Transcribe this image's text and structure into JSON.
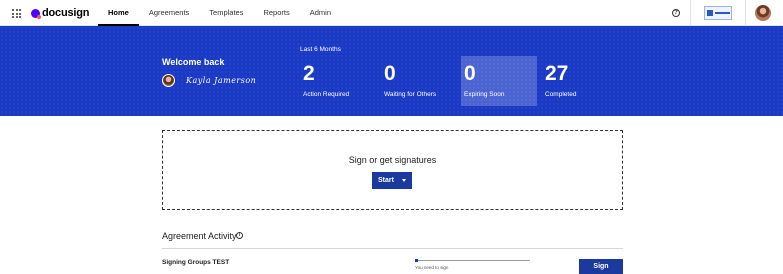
{
  "app": {
    "logo_text": "docusign"
  },
  "nav": {
    "items": [
      {
        "label": "Home",
        "active": true
      },
      {
        "label": "Agreements",
        "active": false
      },
      {
        "label": "Templates",
        "active": false
      },
      {
        "label": "Reports",
        "active": false
      },
      {
        "label": "Admin",
        "active": false
      }
    ],
    "help_glyph": "?"
  },
  "hero": {
    "welcome": "Welcome back",
    "signature": "Kayla Jamerson",
    "period": "Last 6 Months",
    "stats": [
      {
        "value": "2",
        "label": "Action Required"
      },
      {
        "value": "0",
        "label": "Waiting for Others"
      },
      {
        "value": "0",
        "label": "Expiring Soon"
      },
      {
        "value": "27",
        "label": "Completed"
      }
    ]
  },
  "sign_box": {
    "title": "Sign or get signatures",
    "start_label": "Start"
  },
  "activity": {
    "title": "Agreement Activity",
    "info_glyph": "i",
    "rows": [
      {
        "title": "Signing Groups TEST",
        "status": "You need to sign",
        "progress": 0.03,
        "action": "Sign"
      }
    ]
  },
  "colors": {
    "hero_bg": "#1a39c4",
    "button_primary": "#1a3a9e",
    "logo_accent": "#4c00ff"
  },
  "icons": [
    "apps-grid-icon",
    "help-icon",
    "info-icon",
    "caret-down-icon"
  ]
}
